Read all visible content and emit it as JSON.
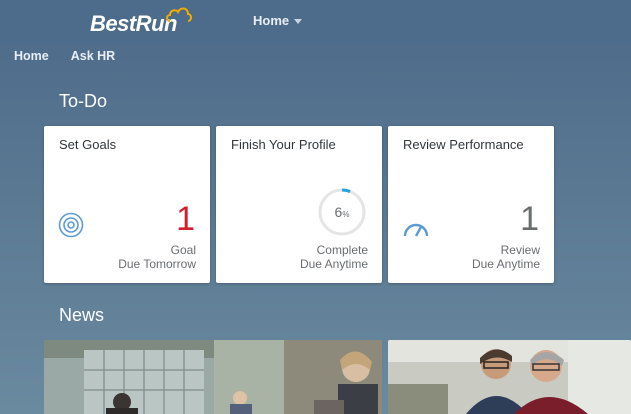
{
  "header": {
    "logo_text": "BestRun",
    "menu_label": "Home"
  },
  "subnav": [
    "Home",
    "Ask HR"
  ],
  "todo": {
    "title": "To-Do",
    "tiles": [
      {
        "title": "Set Goals",
        "number": "1",
        "line1": "Goal",
        "line2": "Due Tomorrow",
        "number_color": "#d0202c",
        "icon": "target-icon"
      },
      {
        "title": "Finish Your Profile",
        "percent": "6",
        "percent_sign": "%",
        "progress": 0.06,
        "line1": "Complete",
        "line2": "Due Anytime",
        "icon": "progress-ring-icon"
      },
      {
        "title": "Review Performance",
        "number": "1",
        "line1": "Review",
        "line2": "Due Anytime",
        "number_color": "#6a6d70",
        "icon": "speedometer-icon"
      }
    ]
  },
  "news": {
    "title": "News"
  },
  "colors": {
    "accent": "#27a1dd",
    "alert": "#d0202c",
    "icon": "#5b9bd5"
  }
}
